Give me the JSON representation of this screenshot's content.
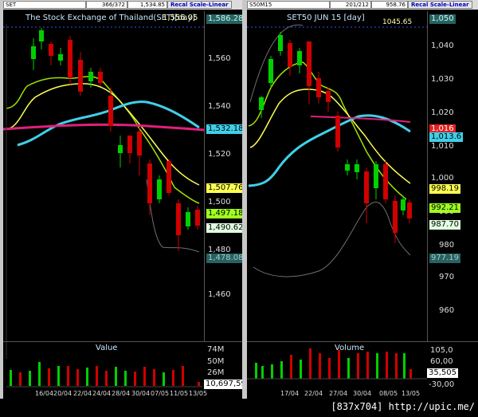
{
  "left": {
    "toolbar": {
      "symbol": "SET",
      "range": "366/372",
      "price": "1,534.85",
      "recal": "Recal Scale-Linear"
    },
    "title": "The Stock Exchange of Thailand(SET)[day]",
    "title_overlay": "1,556.05",
    "top_price": "1,586.28",
    "y_ticks": [
      "1,560",
      "1,540",
      "1,520",
      "1,500",
      "1,480",
      "1,460"
    ],
    "tags": {
      "cyan": "1,532.18",
      "yellow": "1,507.76",
      "green": "1,497.18",
      "white": "1,490.62",
      "teal": "1,478.08"
    },
    "volume": {
      "title": "Value",
      "ticks": [
        "74M",
        "50M",
        "26M"
      ],
      "last": "10,697,59"
    },
    "dates": [
      "16/04",
      "20/04",
      "22/04",
      "24/04",
      "28/04",
      "30/04",
      "07/05",
      "11/05",
      "13/05"
    ]
  },
  "right": {
    "toolbar": {
      "symbol": "S50M15",
      "range": "201/212",
      "price": "958.76",
      "recal": "Recal Scale-Linear"
    },
    "title": "SET50 JUN 15   [day]",
    "title_price": "1045.65",
    "top_price": "1,050",
    "y_ticks": [
      "1,040",
      "1,030",
      "1,020",
      "1,010",
      "1,000",
      "990",
      "980",
      "970",
      "960"
    ],
    "tags": {
      "red": "1,016",
      "cyan": "1,013.6",
      "yellow": "998.19",
      "green": "992.21",
      "white": "987.70",
      "teal": "977.19"
    },
    "volume": {
      "title": "Volume",
      "ticks": [
        "105,0",
        "60,00"
      ],
      "last": "35,505",
      "low": "-30,00"
    },
    "dates": [
      "17/04",
      "22/04",
      "27/04",
      "30/04",
      "08/05",
      "13/05"
    ]
  },
  "watermark": "[837x704] http://upic.me/",
  "colors": {
    "up": "#00d000",
    "down": "#d00000",
    "yellow": "#ffff50",
    "cyan": "#40d0e8",
    "magenta": "#e0207a"
  }
}
